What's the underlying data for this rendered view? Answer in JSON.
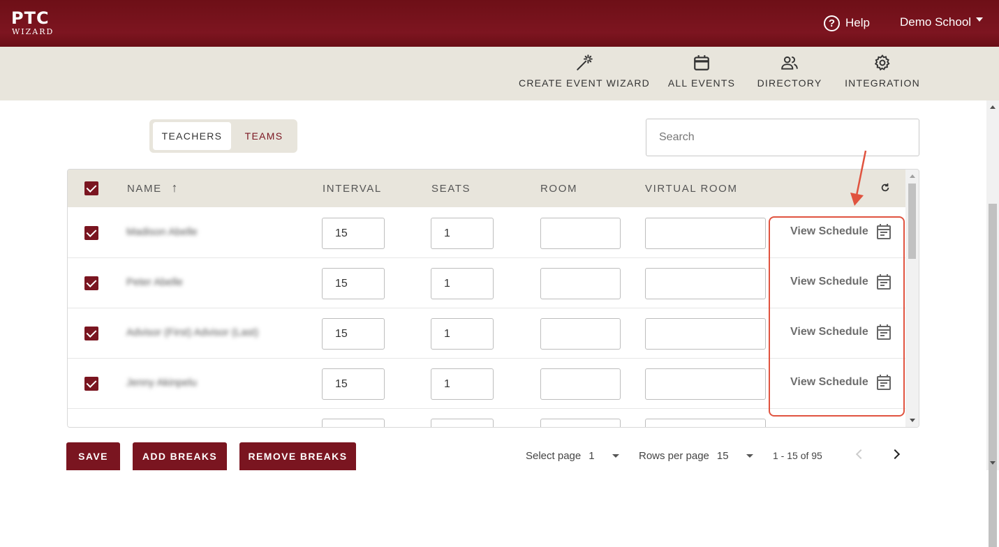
{
  "brand": {
    "logo_main": "PTC",
    "logo_sub": "WIZARD"
  },
  "header": {
    "help_label": "Help",
    "school_label": "Demo School"
  },
  "nav": [
    {
      "label": "CREATE EVENT WIZARD",
      "icon": "magic-wand-icon"
    },
    {
      "label": "ALL EVENTS",
      "icon": "calendar-icon"
    },
    {
      "label": "DIRECTORY",
      "icon": "people-icon"
    },
    {
      "label": "INTEGRATION",
      "icon": "gear-icon"
    }
  ],
  "toggle": {
    "active": "TEACHERS",
    "inactive": "TEAMS"
  },
  "search": {
    "placeholder": "Search"
  },
  "table": {
    "headers": {
      "name": "NAME",
      "interval": "INTERVAL",
      "seats": "SEATS",
      "room": "ROOM",
      "virtual_room": "VIRTUAL ROOM"
    },
    "rows": [
      {
        "name": "Madison Abelle",
        "interval": "15",
        "seats": "1",
        "room": "",
        "virtual_room": "",
        "action": "View Schedule",
        "checked": true
      },
      {
        "name": "Peter Abelle",
        "interval": "15",
        "seats": "1",
        "room": "",
        "virtual_room": "",
        "action": "View Schedule",
        "checked": true
      },
      {
        "name": "Advisor (First) Advisor (Last)",
        "interval": "15",
        "seats": "1",
        "room": "",
        "virtual_room": "",
        "action": "View Schedule",
        "checked": true
      },
      {
        "name": "Jenny Akinpelu",
        "interval": "15",
        "seats": "1",
        "room": "",
        "virtual_room": "",
        "action": "View Schedule",
        "checked": true
      }
    ]
  },
  "buttons": {
    "save": "SAVE",
    "add_breaks": "ADD BREAKS",
    "remove_breaks": "REMOVE BREAKS"
  },
  "pagination": {
    "select_page_label": "Select page",
    "select_page_value": "1",
    "rows_per_page_label": "Rows per page",
    "rows_per_page_value": "15",
    "range": "1 - 15 of 95"
  },
  "colors": {
    "brand": "#7a1520",
    "accent_highlight": "#e0533f",
    "nav_bg": "#e8e5dc"
  }
}
